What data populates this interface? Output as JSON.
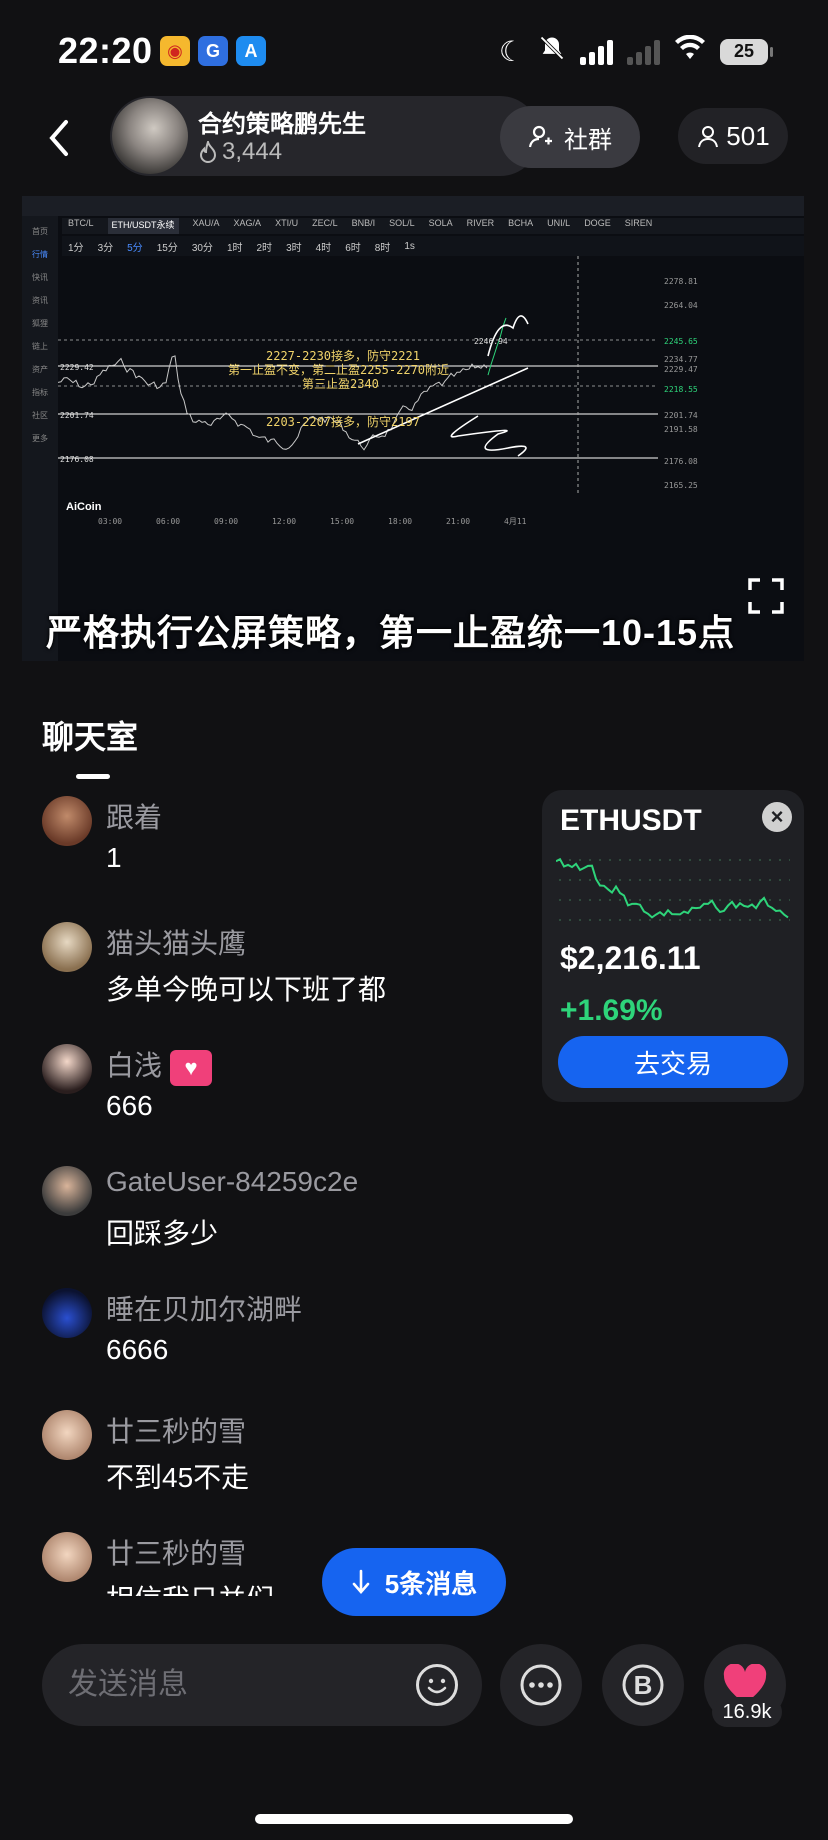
{
  "status_bar": {
    "time": "22:20",
    "battery": "25"
  },
  "header": {
    "host_name": "合约策略鹏先生",
    "heat": "3,444",
    "community_label": "社群",
    "viewers": "501"
  },
  "stream": {
    "caption": "严格执行公屏策略，第一止盈统一10-15点",
    "tv_tabs": [
      "BTC/L",
      "ETH/USDT永续",
      "XAU/A",
      "XAG/A",
      "XTI/U",
      "ZEC/L",
      "BNB/I",
      "SOL/L",
      "SOLA",
      "RIVER",
      "BCHA",
      "UNI/L",
      "DOGE",
      "SIREN"
    ],
    "tv_timeframes": [
      "1分",
      "3分",
      "5分",
      "15分",
      "30分",
      "1时",
      "2时",
      "3时",
      "4时",
      "6时",
      "8时",
      "1s"
    ],
    "tv_side": [
      "首页",
      "行情",
      "快讯",
      "资讯",
      "狐狸",
      "链上",
      "资产",
      "指标",
      "社区",
      "更多"
    ],
    "annotations": [
      "2227-2230接多，防守2221",
      "第一止盈不变，第二止盈2255-2270附近",
      "第三止盈2340",
      "2203-2207接多，防守2197"
    ],
    "price_labels": [
      "2278.81",
      "2264.04",
      "2245.65",
      "2234.77",
      "2229.47",
      "2218.55",
      "2201.74",
      "2191.58",
      "2176.08",
      "2165.25"
    ],
    "left_labels": [
      "2229.42",
      "2201.74",
      "2176.08"
    ],
    "peak_label": "2246.94",
    "time_labels": [
      "03:00",
      "06:00",
      "09:00",
      "12:00",
      "15:00",
      "18:00",
      "21:00",
      "4月11"
    ],
    "watermark": "AiCoin"
  },
  "chat": {
    "title": "聊天室",
    "messages": [
      {
        "user": "跟着",
        "text": "1"
      },
      {
        "user": "猫头猫头鹰",
        "text": "多单今晚可以下班了都"
      },
      {
        "user": "白浅",
        "text": "666"
      },
      {
        "user": "GateUser-84259c2e",
        "text": "回踩多少"
      },
      {
        "user": "睡在贝加尔湖畔",
        "text": "6666"
      },
      {
        "user": "廿三秒的雪",
        "text": "不到45不走"
      },
      {
        "user": "廿三秒的雪",
        "text": "相信我只并们"
      }
    ]
  },
  "ticker": {
    "symbol": "ETHUSDT",
    "price": "$2,216.11",
    "change": "+1.69%",
    "trade_label": "去交易",
    "up_color": "#2ed47a"
  },
  "new_messages": {
    "label": "5条消息"
  },
  "input": {
    "placeholder": "发送消息"
  },
  "like": {
    "count": "16.9k"
  },
  "colors": {
    "accent": "#1664f0",
    "background": "#111113",
    "like": "#f0407a"
  }
}
